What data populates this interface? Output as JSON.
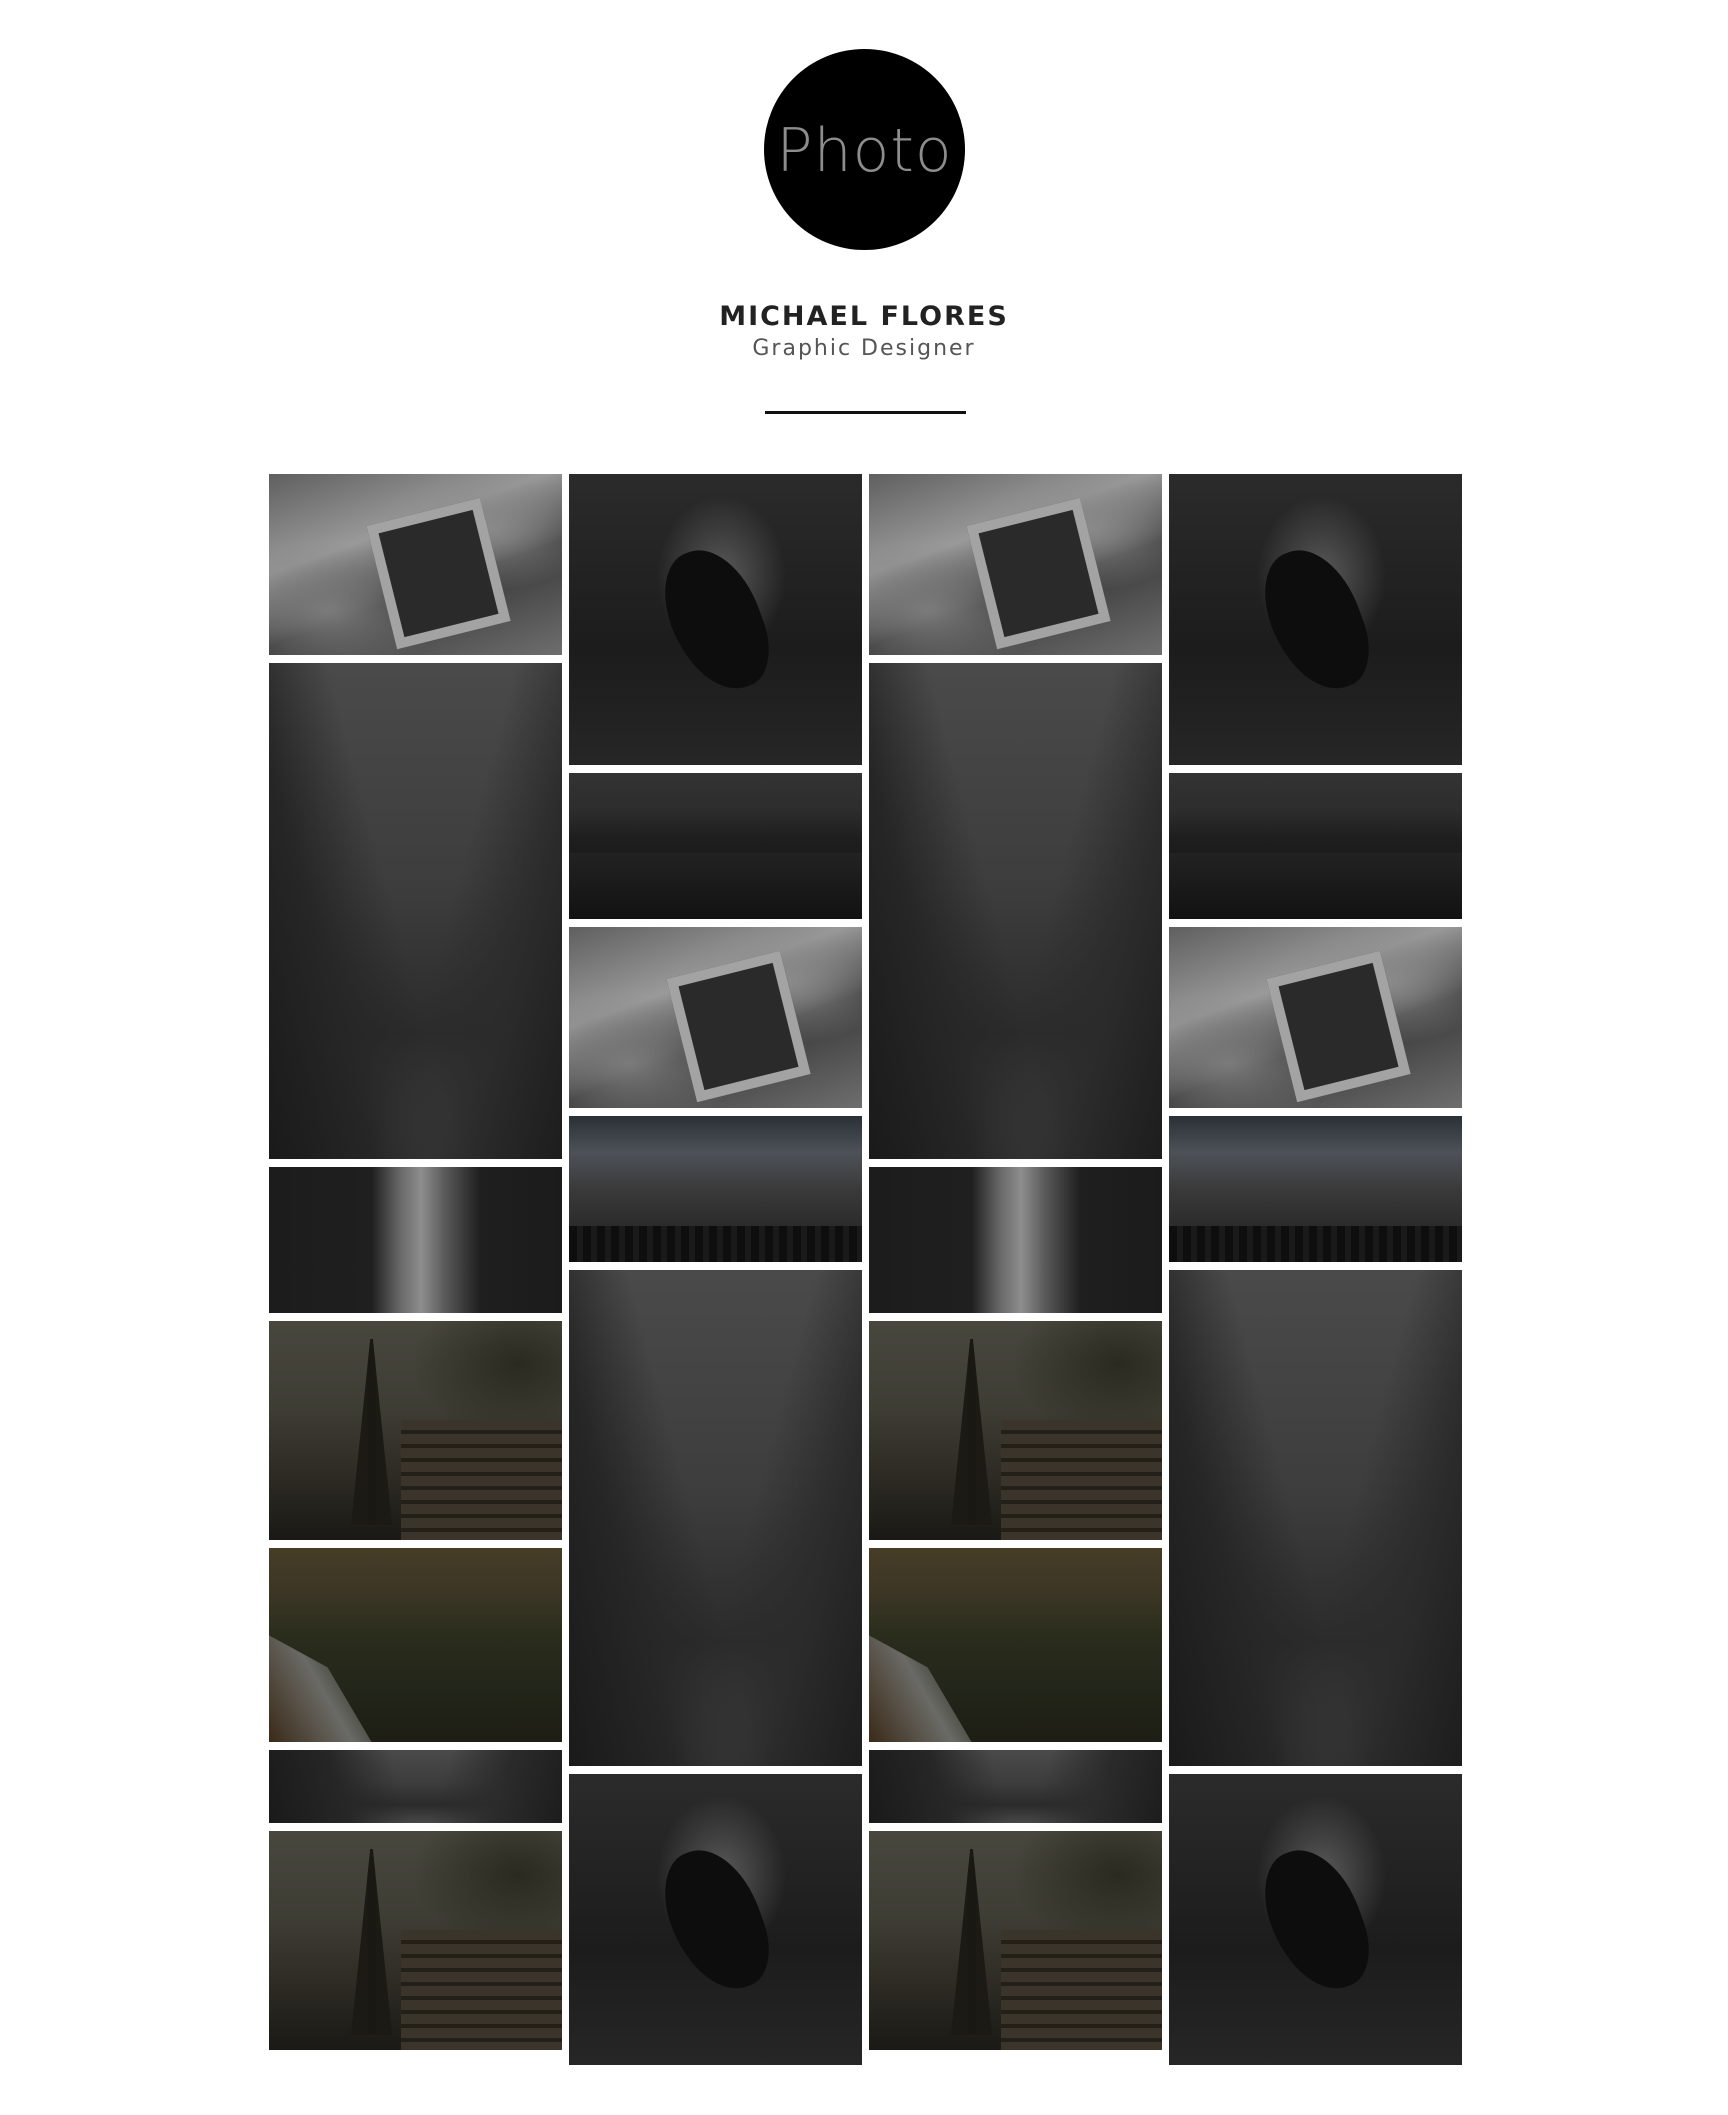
{
  "header": {
    "logo_text": "Photo",
    "name": "MICHAEL FLORES",
    "role": "Graphic Designer"
  },
  "gallery": {
    "columns": [
      [
        "car",
        "canyon",
        "waterfall",
        "paris",
        "hills",
        "canyon",
        "paris"
      ],
      [
        "diver",
        "rocks",
        "car",
        "mist",
        "canyon",
        "diver"
      ],
      [
        "car",
        "canyon",
        "waterfall",
        "paris",
        "hills",
        "canyon",
        "paris"
      ],
      [
        "diver",
        "rocks",
        "car",
        "mist",
        "canyon",
        "diver"
      ]
    ]
  }
}
